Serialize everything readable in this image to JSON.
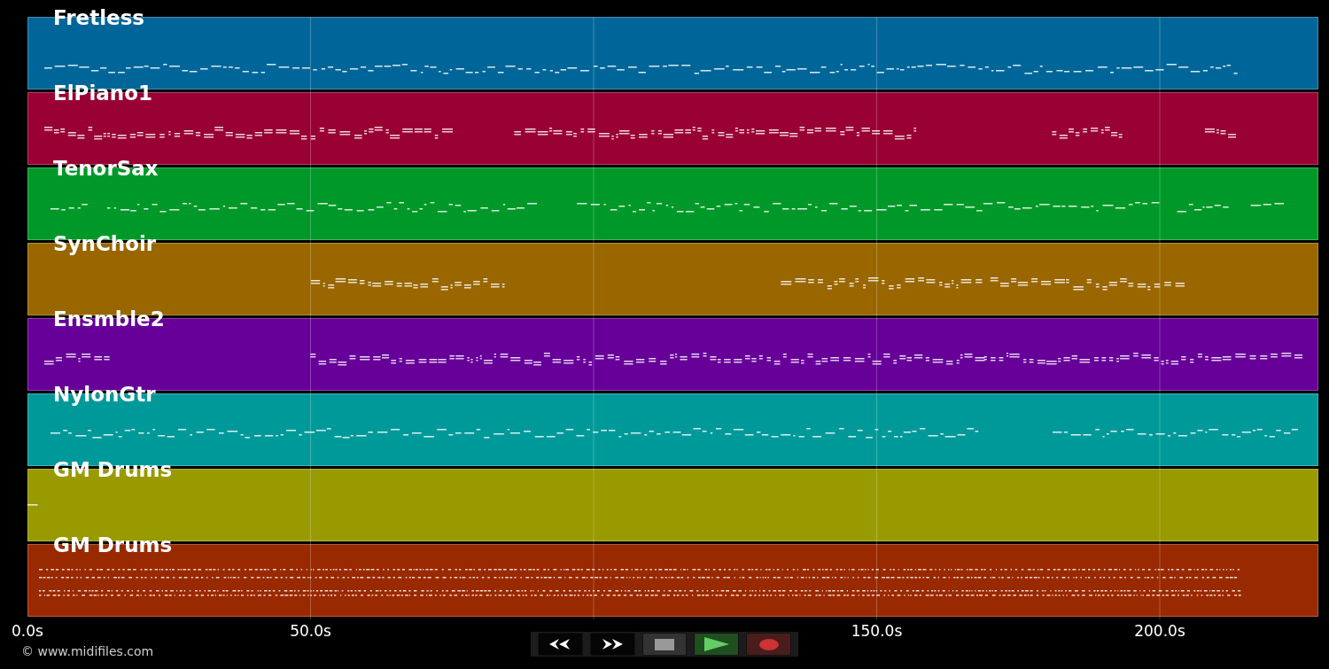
{
  "tracks": [
    {
      "name": "Fretless",
      "color": "#006699"
    },
    {
      "name": "ElPiano1",
      "color": "#990033"
    },
    {
      "name": "TenorSax",
      "color": "#009929"
    },
    {
      "name": "SynChoir",
      "color": "#996600"
    },
    {
      "name": "Ensmble2",
      "color": "#660099"
    },
    {
      "name": "NylonGtr",
      "color": "#009999"
    },
    {
      "name": "GM Drums",
      "color": "#999900"
    },
    {
      "name": "GM Drums",
      "color": "#992900"
    }
  ],
  "axis": {
    "ticks": [
      {
        "label": "0.0s"
      },
      {
        "label": "50.0s"
      },
      {
        "label": "150.0s"
      },
      {
        "label": "200.0s"
      }
    ]
  },
  "copyright": "© www.midifiles.com",
  "transport": {
    "buttons": [
      {
        "kind": "rewind"
      },
      {
        "kind": "forward"
      },
      {
        "kind": "stop"
      },
      {
        "kind": "play"
      },
      {
        "kind": "record"
      }
    ]
  }
}
